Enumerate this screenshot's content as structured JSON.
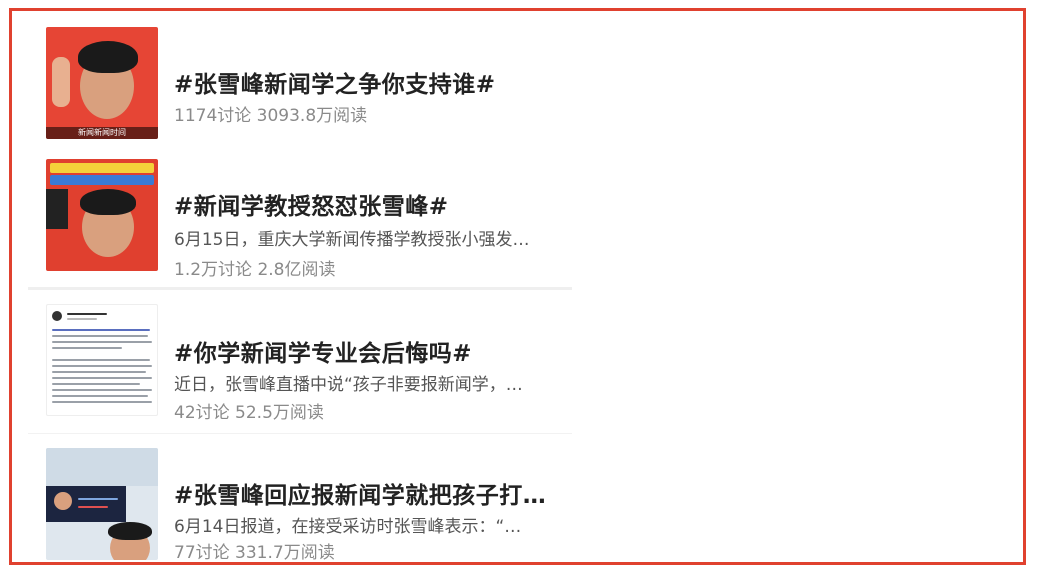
{
  "topics": [
    {
      "title": "#张雪峰新闻学之争你支持谁#",
      "desc": "",
      "stats": "1174讨论 3093.8万阅读",
      "thumb_caption": "新闻新闻时间",
      "thumb_icon": "person-raising-hand-thumbnail"
    },
    {
      "title": "#新闻学教授怒怼张雪峰#",
      "desc": "6月15日，重庆大学新闻传播学教授张小强发…",
      "stats": "1.2万讨论 2.8亿阅读",
      "thumb_icon": "person-portrait-thumbnail"
    },
    {
      "title": "#你学新闻学专业会后悔吗#",
      "desc": "近日，张雪峰直播中说“孩子非要报新闻学，…",
      "stats": "42讨论 52.5万阅读",
      "thumb_icon": "text-post-thumbnail"
    },
    {
      "title": "#张雪峰回应报新闻学就把孩子打…",
      "desc": "6月14日报道，在接受采访时张雪峰表示：“…",
      "stats": "77讨论 331.7万阅读",
      "thumb_icon": "livestream-thumbnail"
    }
  ],
  "colors": {
    "frame_border": "#e0412f",
    "title": "#222222",
    "desc": "#555555",
    "stats": "#8a8a8a"
  }
}
